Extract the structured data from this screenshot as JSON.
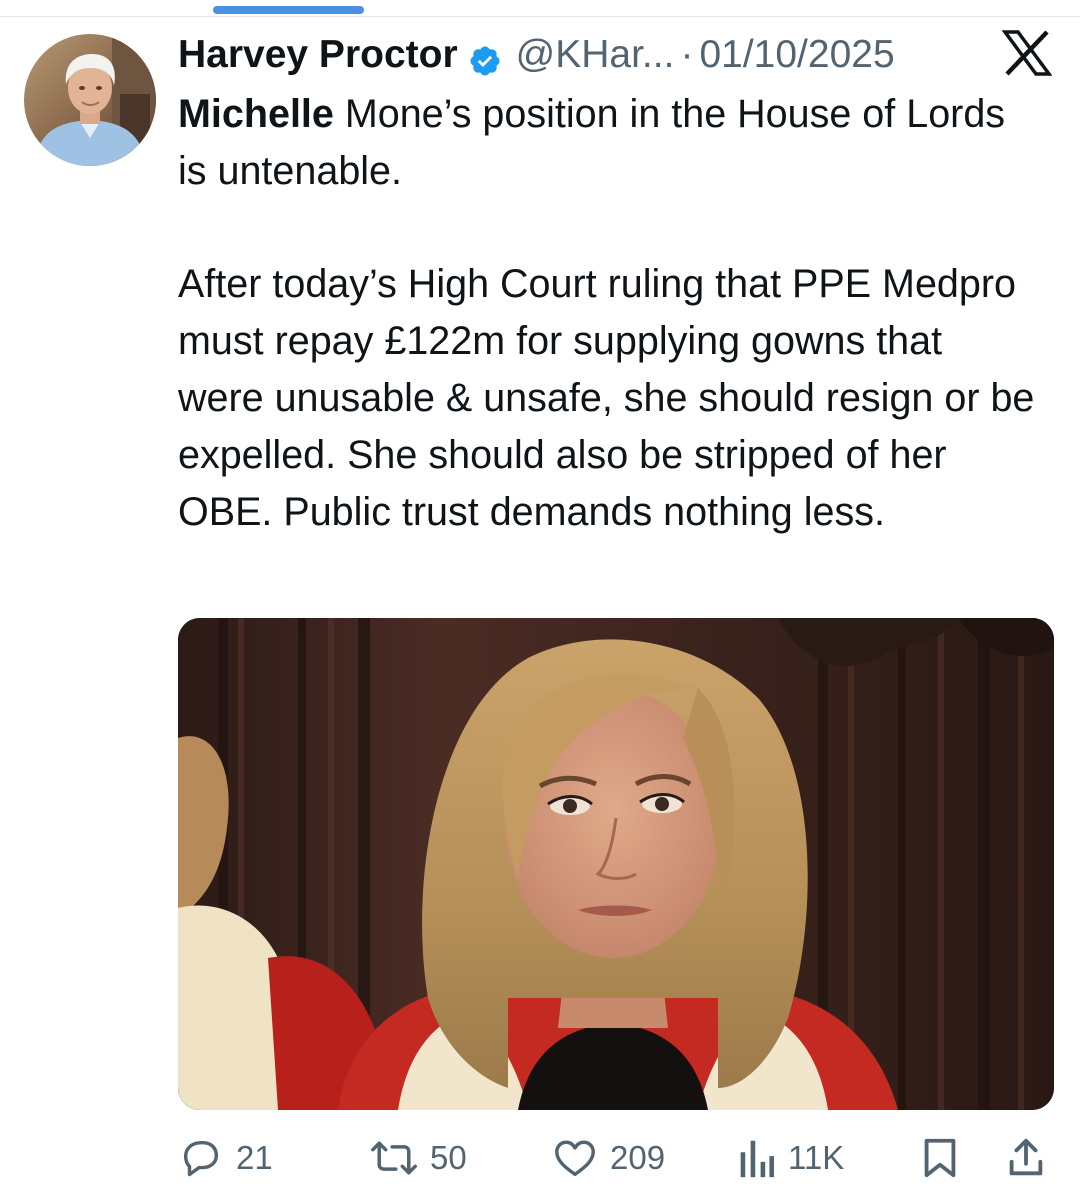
{
  "post": {
    "author": {
      "display_name": "Harvey Proctor",
      "handle": "@KHar...",
      "verified": true
    },
    "separator": "·",
    "date": "01/10/2025",
    "text": {
      "mention": "Michelle",
      "line1_rest": " Mone’s position in the House of Lords is untenable.",
      "paragraph2": "After today’s High Court ruling that PPE Medpro must repay £122m for supplying gowns that were unusable & unsafe, she should resign or be expelled. She should also be stripped of her OBE. Public trust demands nothing less."
    },
    "metrics": {
      "replies": "21",
      "reposts": "50",
      "likes": "209",
      "views": "11K"
    }
  },
  "icons": {
    "verified": "verified-badge-icon",
    "platform": "x-logo-icon",
    "reply": "reply-icon",
    "repost": "repost-icon",
    "like": "heart-icon",
    "views": "views-chart-icon",
    "bookmark": "bookmark-icon",
    "share": "share-icon"
  },
  "colors": {
    "text": "#0f1419",
    "secondary_text": "#536471",
    "verified_blue": "#1d9bf0",
    "tab_indicator": "#4a90e2"
  }
}
